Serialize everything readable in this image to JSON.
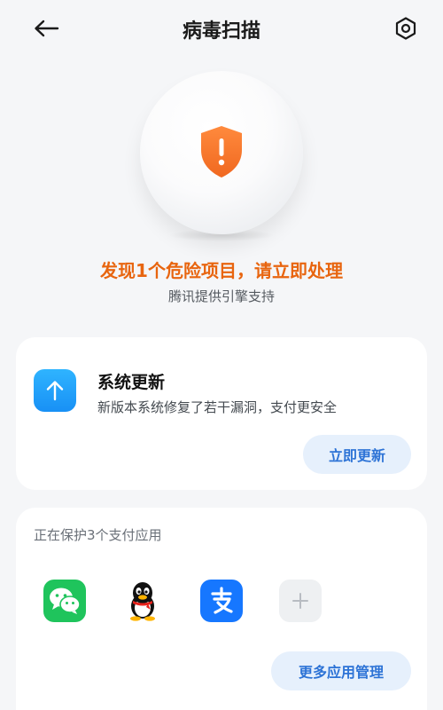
{
  "header": {
    "title": "病毒扫描",
    "back_icon": "back-arrow-icon",
    "settings_icon": "settings-hexagon-icon"
  },
  "status": {
    "alert": "发现1个危险项目，请立即处理",
    "engine": "腾讯提供引擎支持",
    "alert_color": "#e8650f",
    "shield_color": "#f0732a"
  },
  "update_card": {
    "title": "系统更新",
    "description": "新版本系统修复了若干漏洞，支付更安全",
    "button_label": "立即更新",
    "icon": "upload-arrow-icon"
  },
  "protect_card": {
    "label": "正在保护3个支付应用",
    "apps": [
      {
        "name": "wechat",
        "icon": "wechat-icon"
      },
      {
        "name": "qq",
        "icon": "qq-penguin-icon"
      },
      {
        "name": "alipay",
        "icon": "alipay-icon"
      }
    ],
    "add_icon": "plus-icon",
    "button_label": "更多应用管理"
  },
  "colors": {
    "accent_blue": "#2d73d6",
    "button_bg": "#e6f0fc",
    "page_bg": "#f5f6f8"
  }
}
